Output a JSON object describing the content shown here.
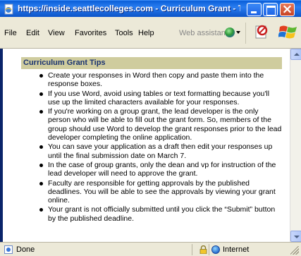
{
  "window": {
    "title": "https://inside.seattlecolleges.com - Curriculum Grant - Tips ..."
  },
  "menu": {
    "items": [
      "File",
      "Edit",
      "View",
      "Favorites",
      "Tools",
      "Help"
    ],
    "web_assistant": "Web assistant"
  },
  "content": {
    "header": "Curriculum Grant Tips",
    "tips": [
      "Create your responses in Word then copy and paste them into the response boxes.",
      "If you use Word, avoid using tables or text formatting because you'll use up the limited characters available for your responses.",
      "If you're working on a group grant, the lead developer is the only person who will be able to fill out the grant form. So, members of the group should use Word to develop the grant responses prior to the lead developer completing the online application.",
      "You can save your application as a draft then edit your responses up until the final submission date on March 7.",
      "In the case of group grants, only the dean and vp for instruction of the lead developer will need to approve the grant.",
      "Faculty are responsible for getting approvals by the published deadlines. You will be able to see the approvals by viewing your grant online.",
      "Your grant is not officially submitted until you click the “Submit” button by the published deadline."
    ]
  },
  "status": {
    "text": "Done",
    "zone": "Internet"
  },
  "icons": {
    "title": "ie-page-icon",
    "web_assistant": "globe-icon",
    "toolbar": "pdf-icon",
    "logo": "windows-logo-icon",
    "security": "lock-icon",
    "zone": "internet-zone-icon"
  }
}
